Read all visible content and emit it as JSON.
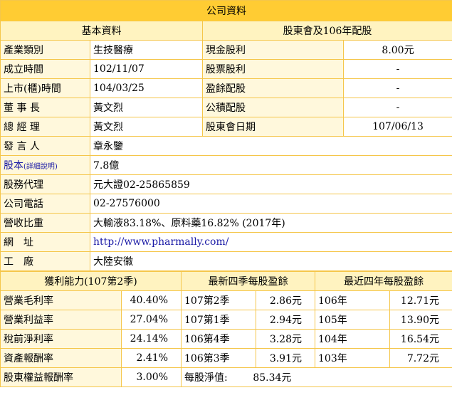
{
  "title": "公司資料",
  "basic": {
    "header": "基本資料",
    "rows": [
      {
        "label": "產業類別",
        "value": "生技醫療"
      },
      {
        "label": "成立時間",
        "value": "102/11/07"
      },
      {
        "label": "上市(櫃)時間",
        "value": "104/03/25"
      },
      {
        "label": "董 事 長",
        "value": "黃文烈"
      },
      {
        "label": "總 經 理",
        "value": "黃文烈"
      }
    ]
  },
  "dividend": {
    "header": "股東會及106年配股",
    "rows": [
      {
        "label": "現金股利",
        "value": "8.00元"
      },
      {
        "label": "股票股利",
        "value": "-"
      },
      {
        "label": "盈餘配股",
        "value": "-"
      },
      {
        "label": "公積配股",
        "value": "-"
      },
      {
        "label": "股東會日期",
        "value": "107/06/13"
      }
    ]
  },
  "more": {
    "spokesperson_label": "發 言 人",
    "spokesperson": "章永鑒",
    "capital_label": "股本",
    "capital_link": "(詳細說明)",
    "capital": "7.8億",
    "agent_label": "股務代理",
    "agent": "元大證02-25865859",
    "phone_label": "公司電話",
    "phone": "02-27576000",
    "revenue_label": "營收比重",
    "revenue": "大輸液83.18%、原料藥16.82% (2017年)",
    "website_label": "網　址",
    "website": "http://www.pharmally.com/",
    "factory_label": "工　廠",
    "factory": "大陸安徽"
  },
  "profit": {
    "header": "獲利能力(107第2季)",
    "rows": [
      {
        "label": "營業毛利率",
        "value": "40.40%"
      },
      {
        "label": "營業利益率",
        "value": "27.04%"
      },
      {
        "label": "稅前淨利率",
        "value": "24.14%"
      },
      {
        "label": "資產報酬率",
        "value": "2.41%"
      },
      {
        "label": "股東權益報酬率",
        "value": "3.00%"
      }
    ]
  },
  "eps4q": {
    "header": "最新四季每股盈餘",
    "rows": [
      {
        "period": "107第2季",
        "value": "2.86元"
      },
      {
        "period": "107第1季",
        "value": "2.94元"
      },
      {
        "period": "106第4季",
        "value": "3.28元"
      },
      {
        "period": "106第3季",
        "value": "3.91元"
      }
    ],
    "nav_label": "每股淨值:",
    "nav_value": "85.34元"
  },
  "eps4y": {
    "header": "最近四年每股盈餘",
    "rows": [
      {
        "year": "106年",
        "value": "12.71元"
      },
      {
        "year": "105年",
        "value": "13.90元"
      },
      {
        "year": "104年",
        "value": "16.54元"
      },
      {
        "year": "103年",
        "value": "7.72元"
      }
    ]
  }
}
